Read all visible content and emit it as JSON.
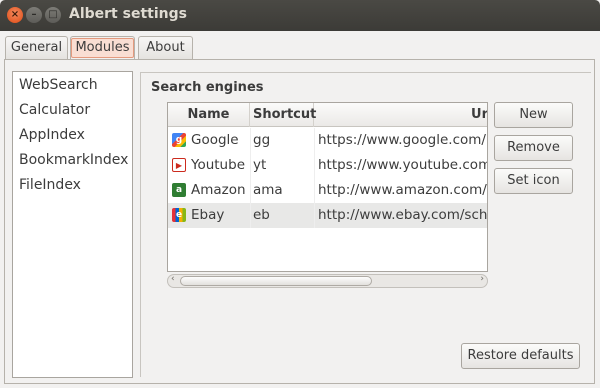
{
  "window": {
    "title": "Albert settings",
    "controls": [
      "close-icon",
      "minimize-icon",
      "maximize-icon"
    ]
  },
  "tabs": [
    {
      "label": "General",
      "active": false
    },
    {
      "label": "Modules",
      "active": true
    },
    {
      "label": "About",
      "active": false
    }
  ],
  "modules": [
    "WebSearch",
    "Calculator",
    "AppIndex",
    "BookmarkIndex",
    "FileIndex"
  ],
  "search_engines": {
    "title": "Search engines",
    "columns": [
      "Name",
      "Shortcut",
      "Ur"
    ],
    "rows": [
      {
        "icon": "google-icon",
        "name": "Google",
        "shortcut": "gg",
        "url": "https://www.google.com/#",
        "selected": false
      },
      {
        "icon": "youtube-icon",
        "name": "Youtube",
        "shortcut": "yt",
        "url": "https://www.youtube.com/",
        "selected": false
      },
      {
        "icon": "amazon-icon",
        "name": "Amazon",
        "shortcut": "ama",
        "url": "http://www.amazon.com/s/",
        "selected": false
      },
      {
        "icon": "ebay-icon",
        "name": "Ebay",
        "shortcut": "eb",
        "url": "http://www.ebay.com/sch/",
        "selected": true
      }
    ],
    "scrollbar_position": 0.0
  },
  "buttons": {
    "new": "New",
    "remove": "Remove",
    "set_icon": "Set icon",
    "restore_defaults": "Restore defaults"
  },
  "colors": {
    "titlebar": "#3c3b37",
    "close_button": "#de4a13",
    "active_tab_highlight": "#f9ded3",
    "selected_row": "#e8e8e7"
  }
}
